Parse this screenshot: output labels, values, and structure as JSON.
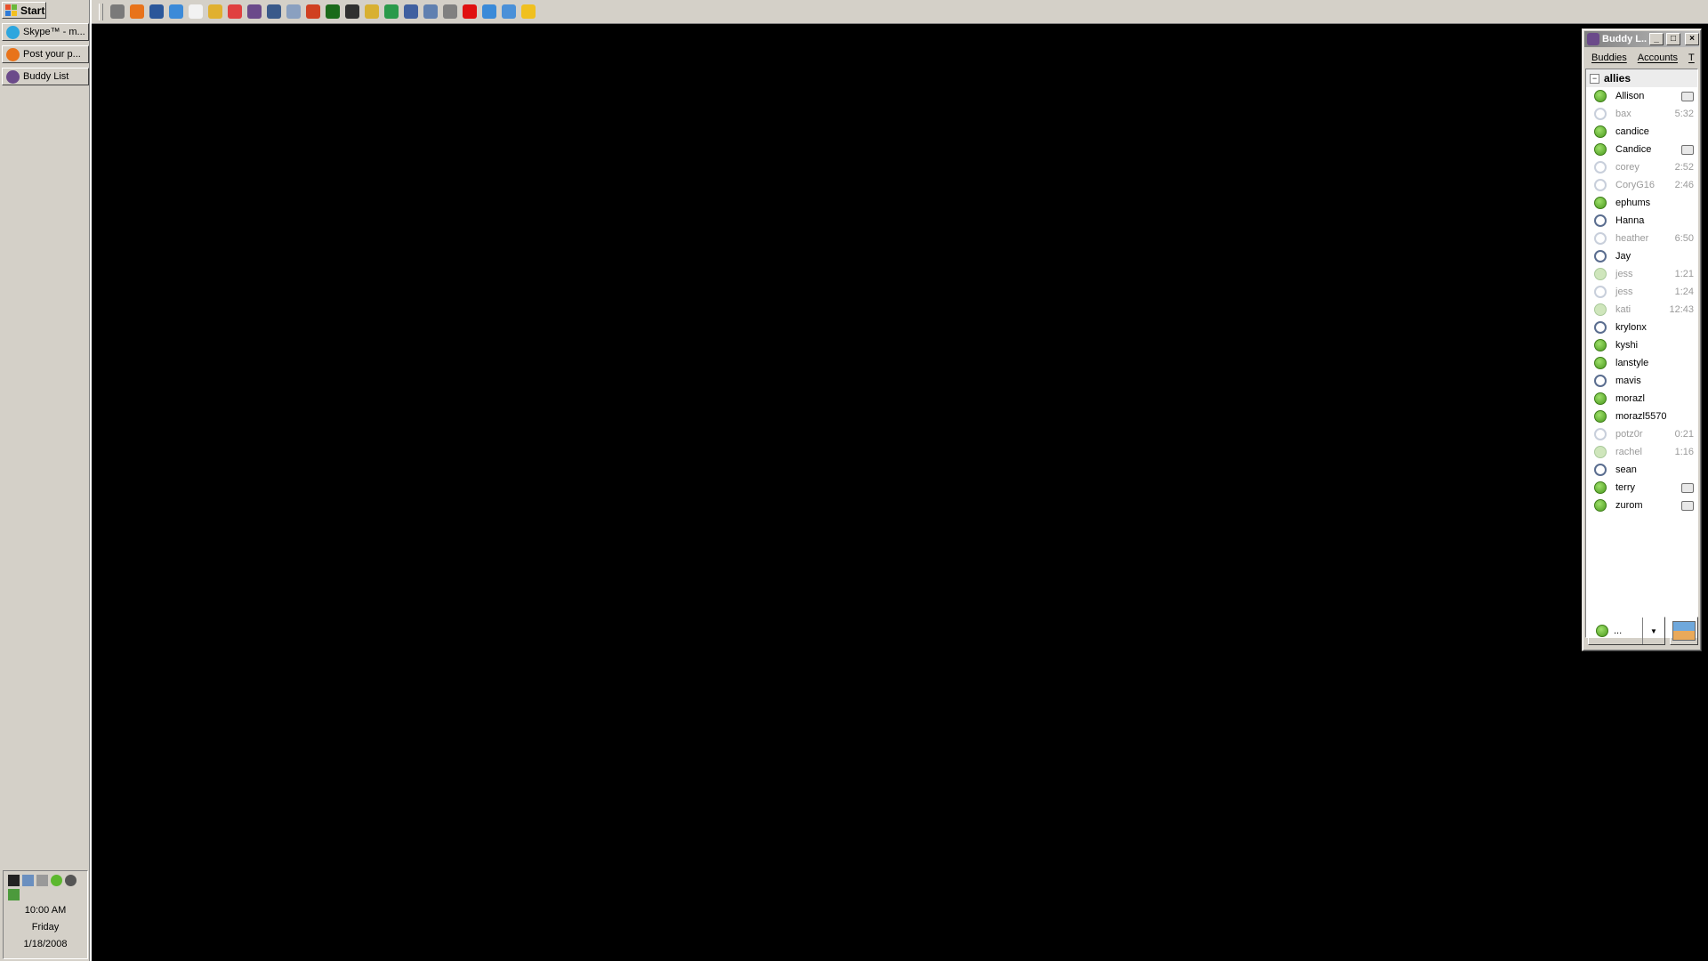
{
  "taskbar": {
    "start_label": "Start",
    "tasks": [
      {
        "label": "Skype™ - m...",
        "icon": "skype-icon",
        "color": "#2ea6de"
      },
      {
        "label": "Post your p...",
        "icon": "firefox-icon",
        "color": "#e8731a"
      },
      {
        "label": "Buddy List",
        "icon": "pidgin-icon",
        "color": "#6b4a8a"
      }
    ],
    "clock": {
      "time": "10:00 AM",
      "day": "Friday",
      "date": "1/18/2008"
    }
  },
  "quicklaunch": {
    "icons": [
      {
        "name": "show-desktop-icon",
        "color": "#7a7a7a"
      },
      {
        "name": "firefox-icon",
        "color": "#e8731a"
      },
      {
        "name": "word-icon",
        "color": "#2b579a"
      },
      {
        "name": "internet-explorer-icon",
        "color": "#3c8ad8"
      },
      {
        "name": "notepad-icon",
        "color": "#f2f2f2"
      },
      {
        "name": "pencil-icon",
        "color": "#e0b030"
      },
      {
        "name": "media-icon",
        "color": "#e04040"
      },
      {
        "name": "pidgin-icon",
        "color": "#6b4a8a"
      },
      {
        "name": "window-icon",
        "color": "#3a5a8a"
      },
      {
        "name": "calculator-icon",
        "color": "#8aa0c0"
      },
      {
        "name": "paint-icon",
        "color": "#d04020"
      },
      {
        "name": "terminal-icon",
        "color": "#1a6a1a"
      },
      {
        "name": "gear-icon",
        "color": "#303030"
      },
      {
        "name": "folder-icon",
        "color": "#d8b030"
      },
      {
        "name": "globe-icon",
        "color": "#2a9a4a"
      },
      {
        "name": "network-icon",
        "color": "#4060a0"
      },
      {
        "name": "printer-icon",
        "color": "#6080b0"
      },
      {
        "name": "tools-icon",
        "color": "#808080"
      },
      {
        "name": "spider-icon",
        "color": "#e01010"
      },
      {
        "name": "search-icon",
        "color": "#3a8ad8"
      },
      {
        "name": "music-icon",
        "color": "#4a90d8"
      },
      {
        "name": "aim-icon",
        "color": "#f0c020"
      }
    ]
  },
  "buddy_window": {
    "title": "Buddy L...",
    "menu": [
      "Buddies",
      "Accounts",
      "T"
    ],
    "group": "allies",
    "buddies": [
      {
        "name": "Allison",
        "status": "available",
        "right": "",
        "mobile": true
      },
      {
        "name": "bax",
        "status": "idle-away",
        "right": "5:32",
        "mobile": false
      },
      {
        "name": "candice",
        "status": "available",
        "right": "",
        "mobile": false
      },
      {
        "name": "Candice",
        "status": "available",
        "right": "",
        "mobile": true
      },
      {
        "name": "corey",
        "status": "idle-away",
        "right": "2:52",
        "mobile": false
      },
      {
        "name": "CoryG16",
        "status": "idle-away",
        "right": "2:46",
        "mobile": false
      },
      {
        "name": "ephums",
        "status": "available",
        "right": "",
        "mobile": false
      },
      {
        "name": "Hanna",
        "status": "away",
        "right": "",
        "mobile": false
      },
      {
        "name": "heather",
        "status": "idle-away",
        "right": "6:50",
        "mobile": false
      },
      {
        "name": "Jay",
        "status": "away",
        "right": "",
        "mobile": false
      },
      {
        "name": "jess",
        "status": "idle-avail",
        "right": "1:21",
        "mobile": false
      },
      {
        "name": "jess",
        "status": "idle-away",
        "right": "1:24",
        "mobile": false
      },
      {
        "name": "kati",
        "status": "idle-avail",
        "right": "12:43",
        "mobile": false
      },
      {
        "name": "krylonx",
        "status": "away",
        "right": "",
        "mobile": false
      },
      {
        "name": "kyshi",
        "status": "available",
        "right": "",
        "mobile": false
      },
      {
        "name": "lanstyle",
        "status": "available",
        "right": "",
        "mobile": false
      },
      {
        "name": "mavis",
        "status": "away",
        "right": "",
        "mobile": false
      },
      {
        "name": "morazl",
        "status": "available",
        "right": "",
        "mobile": false
      },
      {
        "name": "morazl5570",
        "status": "available",
        "right": "",
        "mobile": false
      },
      {
        "name": "potz0r",
        "status": "idle-away",
        "right": "0:21",
        "mobile": false
      },
      {
        "name": "rachel",
        "status": "idle-avail",
        "right": "1:16",
        "mobile": false
      },
      {
        "name": "sean",
        "status": "away",
        "right": "",
        "mobile": false
      },
      {
        "name": "terry",
        "status": "available",
        "right": "",
        "mobile": true
      },
      {
        "name": "zurom",
        "status": "available",
        "right": "",
        "mobile": true
      }
    ],
    "status_label": "..."
  }
}
